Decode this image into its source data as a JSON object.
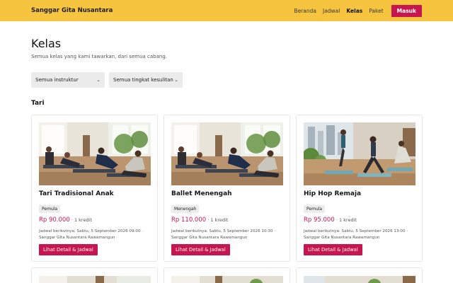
{
  "header": {
    "brand": "Sanggar Gita Nusantara",
    "nav": [
      "Beranda",
      "Jadwal",
      "Kelas",
      "Paket"
    ],
    "active_nav": "Kelas",
    "login_label": "Masuk",
    "accent_color": "#f6c43f",
    "button_color": "#c7164f"
  },
  "page": {
    "title": "Kelas",
    "subtitle": "Semua kelas yang kami tawarkan, dari semua cabang."
  },
  "filters": {
    "instructor": "Semua instruktur",
    "difficulty": "Semua tingkat kesulitan"
  },
  "section": {
    "title": "Tari"
  },
  "cards": [
    {
      "name": "Tari Tradisional Anak",
      "level": "Pemula",
      "price": "Rp 90.000",
      "credit": "· 1 kredit",
      "schedule": "Jadwal berikutnya: Sabtu, 5 September 2026 09:00 · Sanggar Gita Nusantara Rawamangun",
      "button": "Lihat Detail & Jadwal",
      "image": "studio-floor-class-photo"
    },
    {
      "name": "Ballet Menengah",
      "level": "Menengah",
      "price": "Rp 110.000",
      "credit": "· 1 kredit",
      "schedule": "Jadwal berikutnya: Sabtu, 5 September 2026 10:30 · Sanggar Gita Nusantara Rawamangun",
      "button": "Lihat Detail & Jadwal",
      "image": "studio-floor-class-photo"
    },
    {
      "name": "Hip Hop Remaja",
      "level": "Pemula",
      "price": "Rp 95.000",
      "credit": "· 1 kredit",
      "schedule": "Jadwal berikutnya: Sabtu, 5 September 2026 13:00 · Sanggar Gita Nusantara Rawamangun",
      "button": "Lihat Detail & Jadwal",
      "image": "studio-standing-pose-photo"
    }
  ]
}
